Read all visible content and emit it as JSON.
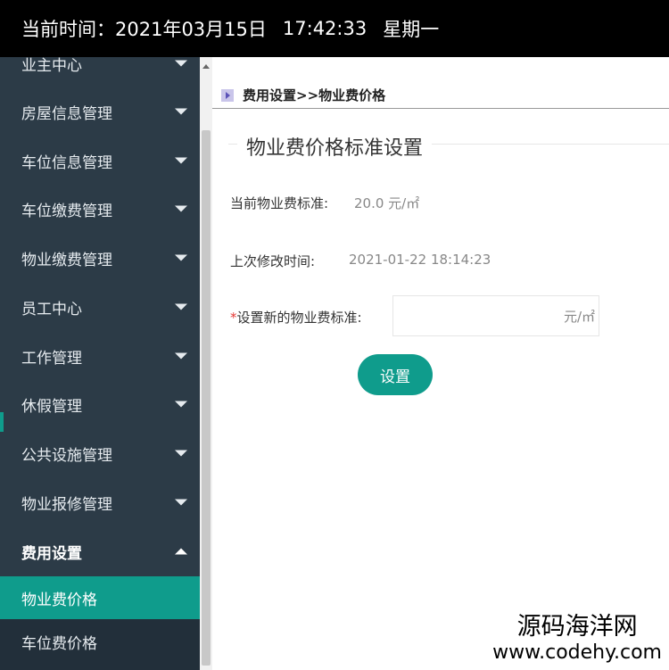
{
  "topbar": {
    "time_label": "当前时间：2021年03月15日",
    "clock": "17:42:33",
    "weekday": "星期一"
  },
  "sidebar": {
    "items": [
      {
        "label": "业主中心"
      },
      {
        "label": "房屋信息管理"
      },
      {
        "label": "车位信息管理"
      },
      {
        "label": "车位缴费管理"
      },
      {
        "label": "物业缴费管理"
      },
      {
        "label": "员工中心"
      },
      {
        "label": "工作管理"
      },
      {
        "label": "休假管理"
      },
      {
        "label": "公共设施管理"
      },
      {
        "label": "物业报修管理"
      },
      {
        "label": "费用设置"
      }
    ],
    "submenu": {
      "active": "物业费价格",
      "other": "车位费价格"
    }
  },
  "content": {
    "breadcrumb": "费用设置>>物业费价格",
    "section_title": "物业费价格标准设置",
    "current_label": "当前物业费标准:",
    "current_value": "20.0 元/㎡",
    "modified_label": "上次修改时间:",
    "modified_value": "2021-01-22 18:14:23",
    "new_label_star": "*",
    "new_label": "设置新的物业费标准:",
    "new_value": "",
    "unit": "元/㎡",
    "submit_label": "设置"
  },
  "watermark": {
    "line1": "源码海洋网",
    "line2": "www.codehy.com"
  },
  "colors": {
    "accent": "#0f9c8c",
    "sidebar_bg": "#2c3b47",
    "topbar_bg": "#000000"
  }
}
